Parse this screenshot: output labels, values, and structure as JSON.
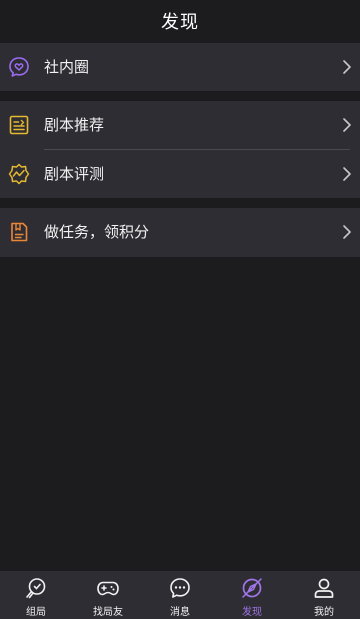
{
  "header": {
    "title": "发现"
  },
  "groups": [
    {
      "items": [
        {
          "label": "社内圈",
          "icon": "chat-heart-icon",
          "color": "#9b6cf0"
        }
      ]
    },
    {
      "items": [
        {
          "label": "剧本推荐",
          "icon": "script-book-icon",
          "color": "#e5b931"
        },
        {
          "label": "剧本评测",
          "icon": "script-review-icon",
          "color": "#e5b931"
        }
      ]
    },
    {
      "items": [
        {
          "label": "做任务，领积分",
          "icon": "task-document-icon",
          "color": "#e98637"
        }
      ]
    }
  ],
  "tabbar": {
    "tabs": [
      {
        "label": "组局",
        "icon": "party-icon",
        "active": false
      },
      {
        "label": "找局友",
        "icon": "gamepad-icon",
        "active": false
      },
      {
        "label": "消息",
        "icon": "message-icon",
        "active": false
      },
      {
        "label": "发现",
        "icon": "discover-icon",
        "active": true
      },
      {
        "label": "我的",
        "icon": "profile-icon",
        "active": false
      }
    ],
    "active_color": "#a076e8"
  }
}
